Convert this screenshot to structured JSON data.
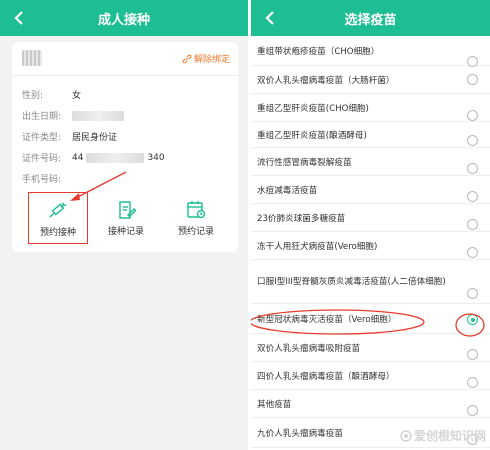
{
  "left": {
    "title": "成人接种",
    "unbind": "解除绑定",
    "info": {
      "gender_label": "性别:",
      "gender_value": "女",
      "birth_label": "出生日期:",
      "cert_type_label": "证件类型:",
      "cert_type_value": "居民身份证",
      "cert_no_label": "证件号码:",
      "cert_no_start": "44",
      "cert_no_end": "340",
      "phone_label": "手机号码:"
    },
    "actions": [
      "预约接种",
      "接种记录",
      "预约记录"
    ]
  },
  "right": {
    "title": "选择疫苗",
    "vaccines": [
      {
        "name": "重组带状疱疹疫苗（CHO细胞）",
        "selected": false
      },
      {
        "name": "双价人乳头瘤病毒疫苗（大肠杆菌）",
        "selected": false
      },
      {
        "name": "重组乙型肝炎疫苗(CHO细胞)",
        "selected": false
      },
      {
        "name": "重组乙型肝炎疫苗(酿酒酵母)",
        "selected": false
      },
      {
        "name": "流行性感冒病毒裂解疫苗",
        "selected": false
      },
      {
        "name": "水痘减毒活疫苗",
        "selected": false
      },
      {
        "name": "23价肺炎球菌多糖疫苗",
        "selected": false
      },
      {
        "name": "冻干人用狂犬病疫苗(Vero细胞)",
        "selected": false
      },
      {
        "name": "口服I型III型脊髓灰质炎减毒活疫苗(人二倍体细胞)",
        "selected": false
      },
      {
        "name": "新型冠状病毒灭活疫苗（Vero细胞）",
        "selected": true
      },
      {
        "name": "双价人乳头瘤病毒吸附疫苗",
        "selected": false
      },
      {
        "name": "四价人乳头瘤病毒疫苗（酿酒酵母）",
        "selected": false
      },
      {
        "name": "其他疫苗",
        "selected": false
      },
      {
        "name": "九价人乳头瘤病毒疫苗",
        "selected": false
      }
    ],
    "watermark": "爱创根知识网"
  },
  "colors": {
    "accent": "#1dbe93",
    "highlight": "#e63b2e",
    "unbind": "#f07a2b"
  }
}
